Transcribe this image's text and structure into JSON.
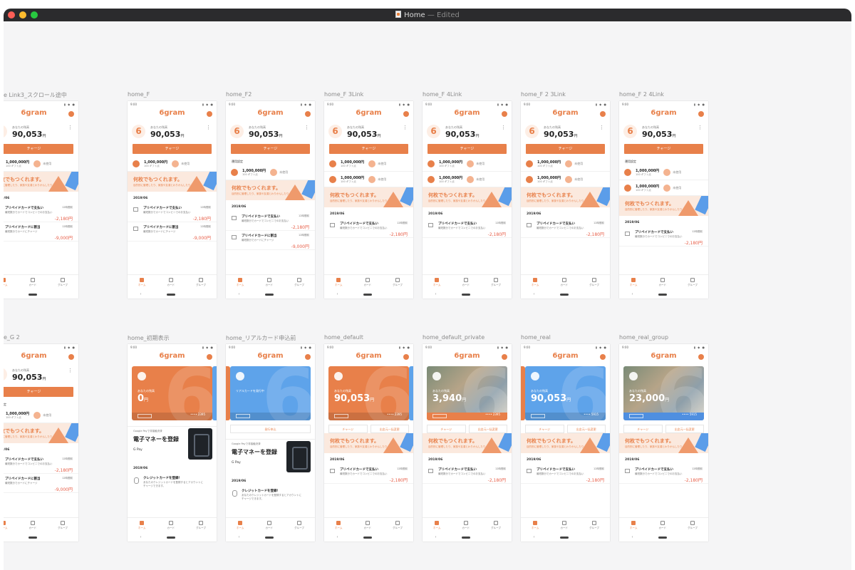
{
  "window": {
    "title": "Home",
    "status": "— Edited"
  },
  "colors": {
    "accent": "#e8804a",
    "blue": "#5ea3ea"
  },
  "common": {
    "logo": "6gram",
    "status_time": "9:00",
    "status_icons": "▮ ◆ ●",
    "balance_label": "あなたの残高",
    "balance_amount": "90,053",
    "yen": "円",
    "charge": "チャージ",
    "banner_title": "何枚でもつくれます。",
    "banner_sub": "目的別に管理したり、家族や友達とわりかんしたり",
    "date_header": "2019/06",
    "tx1_title": "プリペイドカードで支払い",
    "tx1_desc": "最短数分でカードでコンビニでのお支払い",
    "tx1_right": "12時間前",
    "tx1_amount": "-2,180円",
    "tx2_title": "プリペイドカードに割当",
    "tx2_desc": "最短数分でカードにチャージ",
    "tx2_amount": "-9,000円",
    "tab_home": "ホーム",
    "tab_card": "カード",
    "tab_group": "グループ",
    "back": "‹",
    "mini_amount": "1,000,000円",
    "mini_sub": "100 ギフト点",
    "mini_unused": "未使用",
    "mini_unused2": "利用不可中",
    "season": "運用設定",
    "zero": "0円",
    "zero_sub": "1万点 ギフト点",
    "trans_btn1": "チャージ",
    "trans_btn2": "出金元一括変更",
    "gpay_small": "Google Payで非接触決済",
    "gpay_title": "電子マネーを登録",
    "gpay_brand": "G Pay",
    "cc_title": "クレジットカードを登録！",
    "cc_desc": "あなたのクレジットカードを登録するとアカウントにチャージできます。",
    "real_apply": "発行申込",
    "card_label": "あなたの残高",
    "card_label_real": "リアルカードを発行中",
    "card_num": "•••• 2395",
    "card_num2": "•••• 5915",
    "home_amount": "3,940",
    "group_amount": "23,000",
    "init_amount": "0"
  },
  "artboards": [
    {
      "id": "a1",
      "label": "e Link3_スクロール途中"
    },
    {
      "id": "a2",
      "label": "home_F"
    },
    {
      "id": "a3",
      "label": "home_F2"
    },
    {
      "id": "a4",
      "label": "home_F 3Link"
    },
    {
      "id": "a5",
      "label": "home_F 4Link"
    },
    {
      "id": "a6",
      "label": "home_F 2 3Link"
    },
    {
      "id": "a7",
      "label": "home_F 2 4Link"
    },
    {
      "id": "b1",
      "label": "e_G 2"
    },
    {
      "id": "b2",
      "label": "home_初期表示"
    },
    {
      "id": "b3",
      "label": "home_リアルカード申込前"
    },
    {
      "id": "b4",
      "label": "home_default"
    },
    {
      "id": "b5",
      "label": "home_default_private"
    },
    {
      "id": "b6",
      "label": "home_real"
    },
    {
      "id": "b7",
      "label": "home_real_group"
    }
  ]
}
